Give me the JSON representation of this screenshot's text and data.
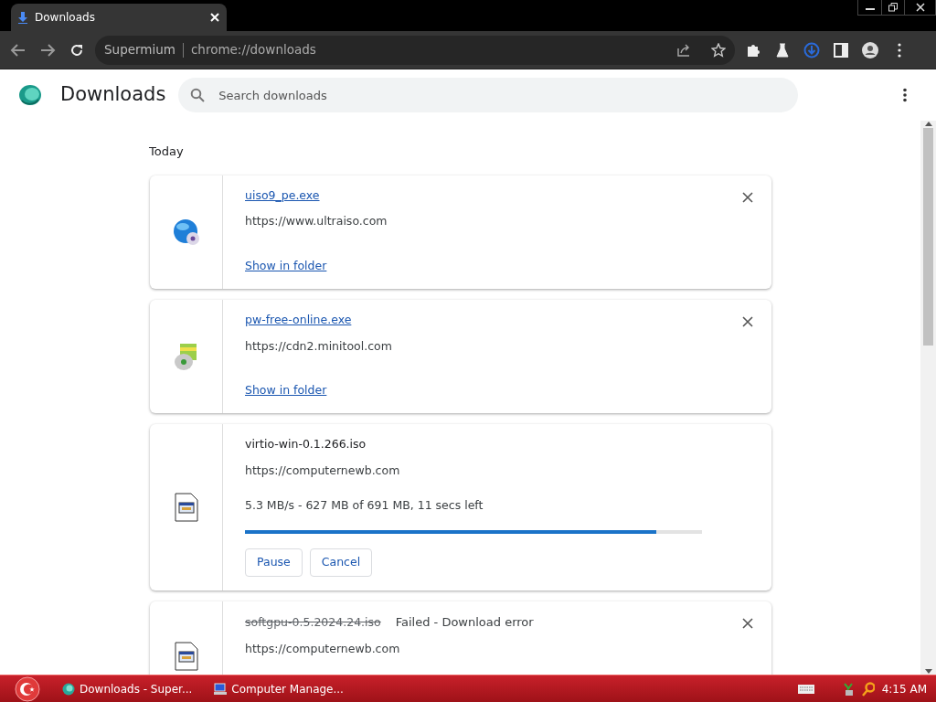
{
  "tab": {
    "title": "Downloads"
  },
  "omnibox": {
    "site_label": "Supermium",
    "url": "chrome://downloads"
  },
  "page": {
    "title": "Downloads",
    "search": {
      "placeholder": "Search downloads"
    }
  },
  "section": "Today",
  "downloads": [
    {
      "kind": "complete",
      "name": "uiso9_pe.exe",
      "url": "https://www.ultraiso.com",
      "link": "Show in folder"
    },
    {
      "kind": "complete",
      "name": "pw-free-online.exe",
      "url": "https://cdn2.minitool.com",
      "link": "Show in folder"
    },
    {
      "kind": "in_progress",
      "name": "virtio-win-0.1.266.iso",
      "url": "https://computernewb.com",
      "status": "5.3 MB/s - 627 MB of 691 MB, 11 secs left",
      "level": 0.9,
      "buttons": [
        "Pause",
        "Cancel"
      ]
    },
    {
      "kind": "failed",
      "name": "softgpu-0.5.2024.24.iso",
      "url": "https://computernewb.com",
      "status": "Failed - Download error"
    }
  ],
  "taskbar": {
    "items": [
      "Downloads - Super...",
      "Computer Manage..."
    ],
    "clock": "4:15 AM"
  }
}
